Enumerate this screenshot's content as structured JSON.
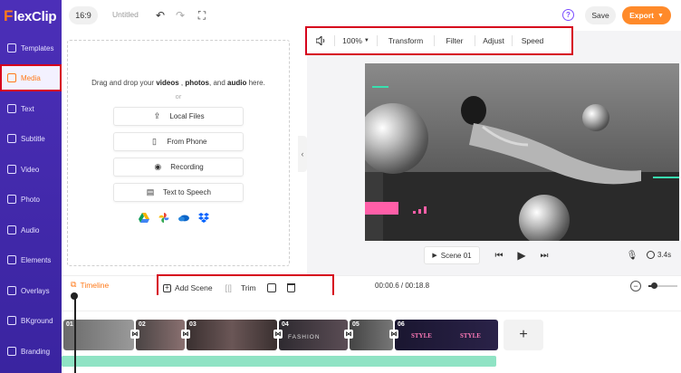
{
  "app": {
    "logo_prefix": "F",
    "logo_rest": "lexClip"
  },
  "sidebar": {
    "items": [
      {
        "label": "Templates"
      },
      {
        "label": "Media"
      },
      {
        "label": "Text"
      },
      {
        "label": "Subtitle"
      },
      {
        "label": "Video"
      },
      {
        "label": "Photo"
      },
      {
        "label": "Audio"
      },
      {
        "label": "Elements"
      },
      {
        "label": "Overlays"
      },
      {
        "label": "BKground"
      },
      {
        "label": "Branding"
      }
    ],
    "active": "Media"
  },
  "topbar": {
    "ratio": "16:9",
    "title": "Untitled",
    "save_label": "Save",
    "export_label": "Export",
    "help": "?"
  },
  "media_panel": {
    "drop_prefix": "Drag and drop your",
    "drop_videos": "videos",
    "drop_photos": "photos",
    "drop_and": ", and",
    "drop_audio": "audio",
    "drop_suffix": "here.",
    "or": "or",
    "buttons": [
      "Local Files",
      "From Phone",
      "Recording",
      "Text to Speech"
    ]
  },
  "toolbar": {
    "volume_zoom": "100%",
    "transform": "Transform",
    "filter": "Filter",
    "adjust": "Adjust",
    "speed": "Speed"
  },
  "player": {
    "scene_label": "Scene 01",
    "duration": "3.4s"
  },
  "timeline": {
    "tab_label": "Timeline",
    "add_scene": "Add Scene",
    "trim": "Trim",
    "time": "00:00.6 / 00:18.8",
    "zoom_level": 0.2,
    "clips": [
      {
        "num": "01"
      },
      {
        "num": "02"
      },
      {
        "num": "03"
      },
      {
        "num": "04"
      },
      {
        "num": "05"
      },
      {
        "num": "06"
      }
    ],
    "clip_texts": [
      "FASHION",
      "STYLE",
      "STYLE"
    ]
  },
  "colors": {
    "brand_purple": "#4c2fb8",
    "accent_orange": "#ff7a1a",
    "highlight_red": "#d6001c"
  }
}
